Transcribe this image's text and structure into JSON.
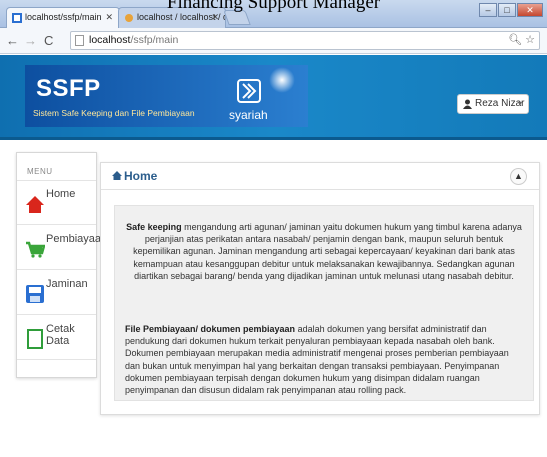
{
  "caption": "Financing Support Manager",
  "browser": {
    "tabs": [
      {
        "label": "localhost/ssfp/main",
        "active": true
      },
      {
        "label": "localhost / localhost / db",
        "active": false
      }
    ],
    "address": {
      "host": "localhost",
      "path": "/ssfp/main"
    }
  },
  "header": {
    "app_name": "SSFP",
    "app_subtitle": "Sistem Safe Keeping dan File Pembiayaan",
    "bank_logo_text": "syariah",
    "user_name": "Reza Nizar"
  },
  "sidebar": {
    "title": "MENU",
    "items": [
      {
        "label": "Home",
        "icon": "home-icon"
      },
      {
        "label": "Pembiayaan",
        "icon": "cart-icon"
      },
      {
        "label": "Jaminan",
        "icon": "save-icon"
      },
      {
        "label": "Cetak Data",
        "icon": "document-icon"
      }
    ]
  },
  "main": {
    "title": "Home",
    "paragraph1": {
      "term": "Safe keeping",
      "text": " mengandung arti agunan/ jaminan yaitu dokumen hukum yang timbul karena adanya perjanjian atas perikatan antara nasabah/ penjamin dengan bank, maupun seluruh bentuk kepemilikan agunan. Jaminan mengandung arti sebagai kepercayaan/ keyakinan dari bank atas kemampuan atau kesanggupan debitur untuk melaksanakan kewajibannya. Sedangkan agunan diartikan sebagai barang/ benda yang dijadikan jaminan untuk melunasi utang nasabah debitur."
    },
    "paragraph2": {
      "term": "File Pembiayaan/ dokumen pembiayaan",
      "text": " adalah dokumen yang bersifat administratif dan pendukung dari dokumen hukum terkait penyaluran pembiayaan kepada nasabah oleh bank. Dokumen pembiayaan merupakan media administratif mengenai proses pemberian pembiayaan dan bukan untuk menyimpan hal yang berkaitan dengan transaksi pembiayaan. Penyimpanan dokumen pembiayaan terpisah dengan dokumen hukum yang disimpan didalam ruangan penyimpanan dan disusun didalam rak penyimpanan atau rolling pack."
    }
  },
  "colors": {
    "header_blue": "#1a88c9",
    "brand_box": "#0d4fa0",
    "subtitle_yellow": "#ffe79a",
    "home_red": "#d9261c",
    "cart_green": "#3aa53a",
    "save_blue": "#2a6fd1",
    "doc_green": "#2f9d3a"
  }
}
